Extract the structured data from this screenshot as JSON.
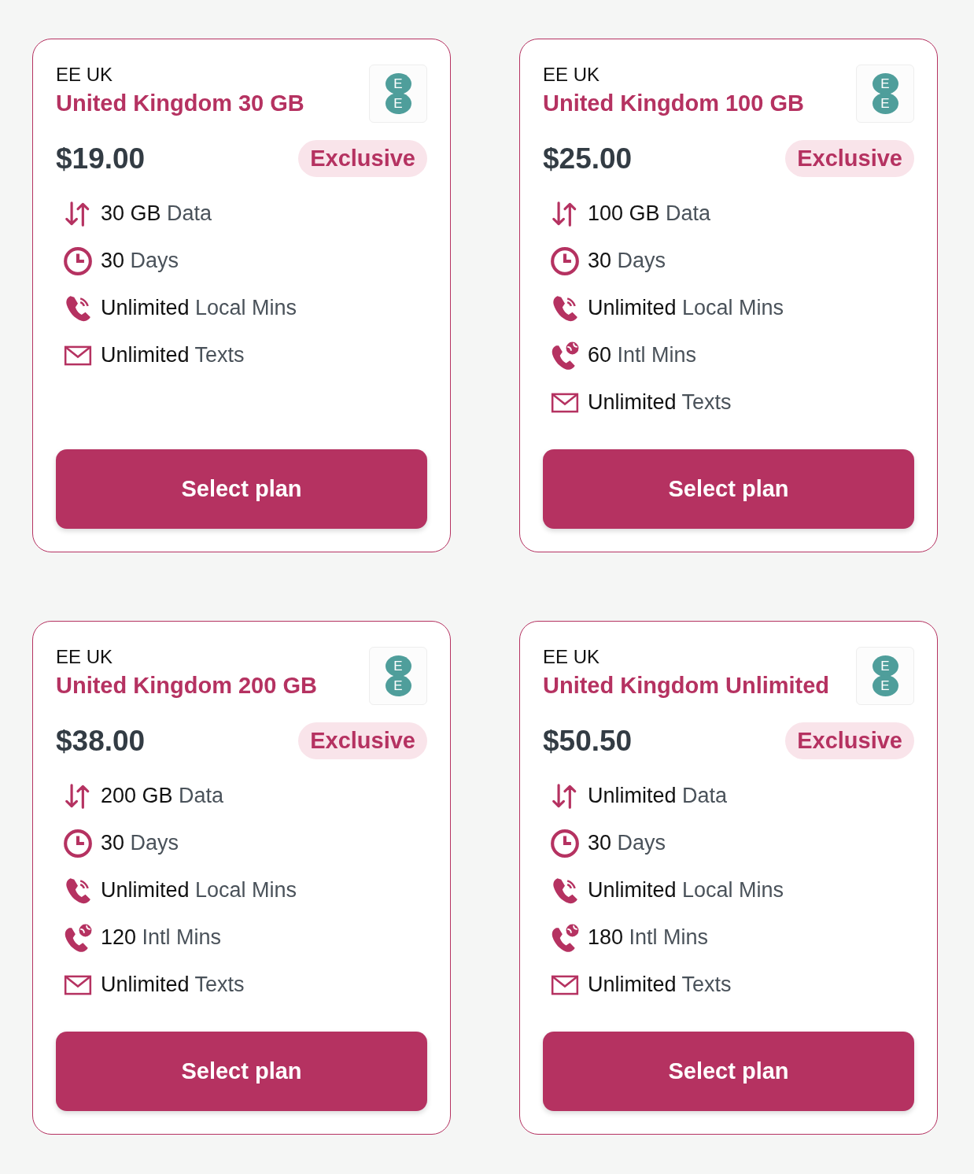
{
  "plans": [
    {
      "provider": "EE UK",
      "title": "United Kingdom 30 GB",
      "logo": {
        "letters": [
          "E",
          "E"
        ]
      },
      "price": "$19.00",
      "badge": "Exclusive",
      "features": [
        {
          "kind": "data",
          "value": "30 GB",
          "label": "Data"
        },
        {
          "kind": "duration",
          "value": "30",
          "label": "Days"
        },
        {
          "kind": "local_calls",
          "value": "Unlimited",
          "label": "Local Mins"
        },
        {
          "kind": "texts",
          "value": "Unlimited",
          "label": "Texts"
        }
      ],
      "button": "Select plan"
    },
    {
      "provider": "EE UK",
      "title": "United Kingdom 100 GB",
      "logo": {
        "letters": [
          "E",
          "E"
        ]
      },
      "price": "$25.00",
      "badge": "Exclusive",
      "features": [
        {
          "kind": "data",
          "value": "100 GB",
          "label": "Data"
        },
        {
          "kind": "duration",
          "value": "30",
          "label": "Days"
        },
        {
          "kind": "local_calls",
          "value": "Unlimited",
          "label": "Local Mins"
        },
        {
          "kind": "intl_calls",
          "value": "60",
          "label": "Intl Mins"
        },
        {
          "kind": "texts",
          "value": "Unlimited",
          "label": "Texts"
        }
      ],
      "button": "Select plan"
    },
    {
      "provider": "EE UK",
      "title": "United Kingdom 200 GB",
      "logo": {
        "letters": [
          "E",
          "E"
        ]
      },
      "price": "$38.00",
      "badge": "Exclusive",
      "features": [
        {
          "kind": "data",
          "value": "200 GB",
          "label": "Data"
        },
        {
          "kind": "duration",
          "value": "30",
          "label": "Days"
        },
        {
          "kind": "local_calls",
          "value": "Unlimited",
          "label": "Local Mins"
        },
        {
          "kind": "intl_calls",
          "value": "120",
          "label": "Intl Mins"
        },
        {
          "kind": "texts",
          "value": "Unlimited",
          "label": "Texts"
        }
      ],
      "button": "Select plan"
    },
    {
      "provider": "EE UK",
      "title": "United Kingdom Unlimited",
      "logo": {
        "letters": [
          "E",
          "E"
        ]
      },
      "price": "$50.50",
      "badge": "Exclusive",
      "features": [
        {
          "kind": "data",
          "value": "Unlimited",
          "label": "Data"
        },
        {
          "kind": "duration",
          "value": "30",
          "label": "Days"
        },
        {
          "kind": "local_calls",
          "value": "Unlimited",
          "label": "Local Mins"
        },
        {
          "kind": "intl_calls",
          "value": "180",
          "label": "Intl Mins"
        },
        {
          "kind": "texts",
          "value": "Unlimited",
          "label": "Texts"
        }
      ],
      "button": "Select plan"
    }
  ]
}
